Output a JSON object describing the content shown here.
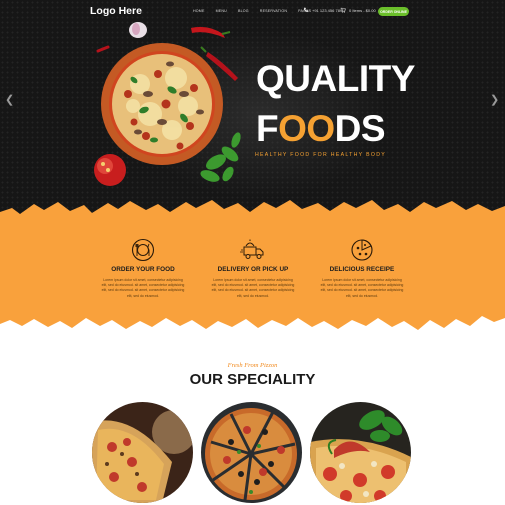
{
  "header": {
    "logo": "Logo Here",
    "nav": [
      "HOME",
      "MENU",
      "BLOG",
      "RESERVATION",
      "PAGES"
    ],
    "phone": "+91 123 456 789",
    "cart": "0 Items - $0.00",
    "order_button": "ORDER ONLINE"
  },
  "hero": {
    "title_line1": "QUALITY",
    "title_line2_a": "F",
    "title_line2_b": "OO",
    "title_line2_c": "DS",
    "subtitle": "HEALTHY FOOD FOR HEALTHY BODY",
    "prev_icon": "chevron-left-icon",
    "next_icon": "chevron-right-icon"
  },
  "features": [
    {
      "title": "ORDER YOUR FOOD",
      "icon": "plate-cutlery-icon",
      "desc": [
        "Lorem ipsum dolor sit amet, consectetur adipisicing",
        "elit, sed do eiusmod. sit amet, consectetur adipisicing",
        "elit, sed do eiusmod. sit amet, consectetur adipisicing",
        "elit, sed do eiusmod."
      ]
    },
    {
      "title": "DELIVERY OR PICK UP",
      "icon": "delivery-truck-icon",
      "desc": [
        "Lorem ipsum dolor sit amet, consectetur adipisicing",
        "elit, sed do eiusmod. sit amet, consectetur adipisicing",
        "elit, sed do eiusmod. sit amet, consectetur adipisicing",
        "elit, sed do eiusmod."
      ]
    },
    {
      "title": "DELICIOUS RECEIPE",
      "icon": "pizza-slice-icon",
      "desc": [
        "Lorem ipsum dolor sit amet, consectetur adipisicing",
        "elit, sed do eiusmod. sit amet, consectetur adipisicing",
        "elit, sed do eiusmod. sit amet, consectetur adipisicing",
        "elit, sed do eiusmod."
      ]
    }
  ],
  "speciality": {
    "subtitle": "Fresh From Pizzon",
    "title": "OUR SPECIALITY"
  },
  "colors": {
    "dark": "#161616",
    "orange": "#f9a13c",
    "accent": "#f5a132",
    "green": "#6bbf2b"
  }
}
